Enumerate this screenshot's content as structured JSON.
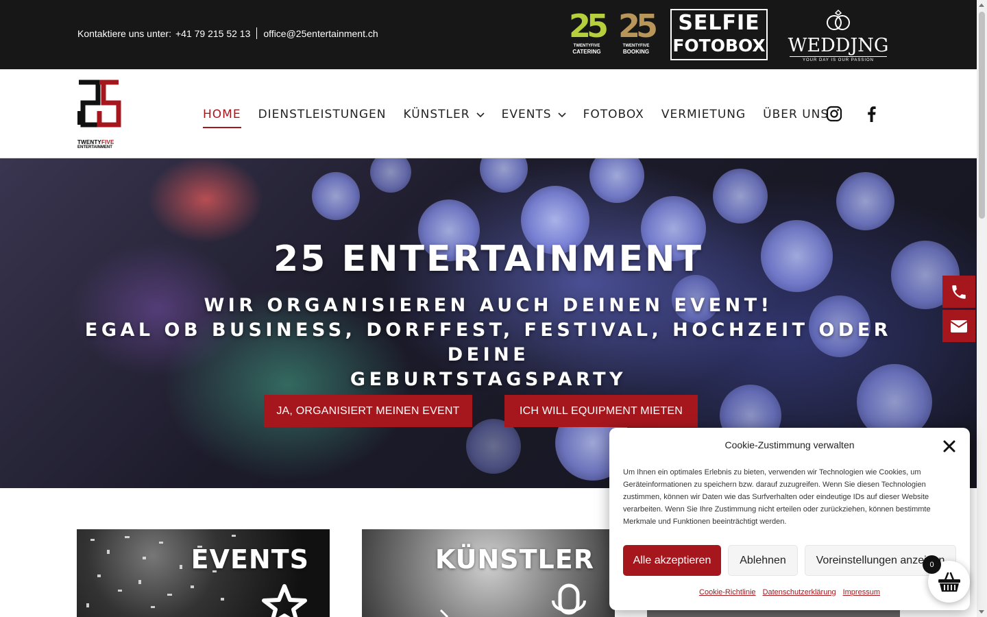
{
  "topbar": {
    "contact_prefix": "Kontaktiere uns unter:",
    "phone": "+41 79 215 52 13",
    "email": "office@25entertainment.ch",
    "partners": [
      {
        "num": "25",
        "sub1": "TWENTYFIVE",
        "sub2": "CATERING",
        "color": "#b6cf3c"
      },
      {
        "num": "25",
        "sub1": "TWENTYFIVE",
        "sub2": "BOOKING",
        "color": "#b8965a"
      }
    ],
    "selfie": {
      "line1": "SELFIE",
      "line2": "FOTOBOX"
    },
    "wedding": {
      "name": "WEDDJNG",
      "tagline": "YOUR DAY IS OUR PASSION"
    }
  },
  "header": {
    "logo": {
      "line1a": "TWENTY",
      "line1b": "FIVE",
      "line2": "ENTERTAINMENT"
    },
    "nav": [
      {
        "label": "HOME",
        "active": true,
        "dropdown": false
      },
      {
        "label": "DIENSTLEISTUNGEN",
        "active": false,
        "dropdown": false
      },
      {
        "label": "KÜNSTLER",
        "active": false,
        "dropdown": true
      },
      {
        "label": "EVENTS",
        "active": false,
        "dropdown": true
      },
      {
        "label": "FOTOBOX",
        "active": false,
        "dropdown": false
      },
      {
        "label": "VERMIETUNG",
        "active": false,
        "dropdown": false
      },
      {
        "label": "ÜBER UNS",
        "active": false,
        "dropdown": false
      }
    ],
    "social": [
      "instagram-icon",
      "facebook-icon"
    ]
  },
  "hero": {
    "title": "25 ENTERTAINMENT",
    "subtitle_line1": "WIR ORGANISIEREN AUCH DEINEN EVENT!",
    "subtitle_line2": "EGAL OB BUSINESS, DORFFEST, FESTIVAL, HOCHZEIT ODER DEINE",
    "subtitle_line3": "GEBURTSTAGSPARTY",
    "button_primary": "JA, ORGANISIERT MEINEN EVENT",
    "button_secondary": "ICH WILL EQUIPMENT MIETEN"
  },
  "cards": [
    {
      "title": "EVENTS",
      "icon": "star-icon"
    },
    {
      "title": "KÜNSTLER",
      "icon": "microphone-icon"
    }
  ],
  "cookie": {
    "title": "Cookie-Zustimmung verwalten",
    "text": "Um Ihnen ein optimales Erlebnis zu bieten, verwenden wir Technologien wie Cookies, um Geräteinformationen zu speichern bzw. darauf zuzugreifen. Wenn Sie diesen Technologien zustimmen, können wir Daten wie das Surfverhalten oder eindeutige IDs auf dieser Website verarbeiten. Wenn Sie Ihre Zustimmung nicht erteilen oder zurückziehen, können bestimmte Merkmale und Funktionen beeinträchtigt werden.",
    "accept": "Alle akzeptieren",
    "decline": "Ablehnen",
    "preferences": "Voreinstellungen anzeigen",
    "links": [
      "Cookie-Richtlinie",
      "Datenschutzerklärung",
      "Impressum"
    ]
  },
  "cart": {
    "count": "0"
  },
  "colors": {
    "accent": "#a5171d",
    "topbar": "#171717"
  }
}
